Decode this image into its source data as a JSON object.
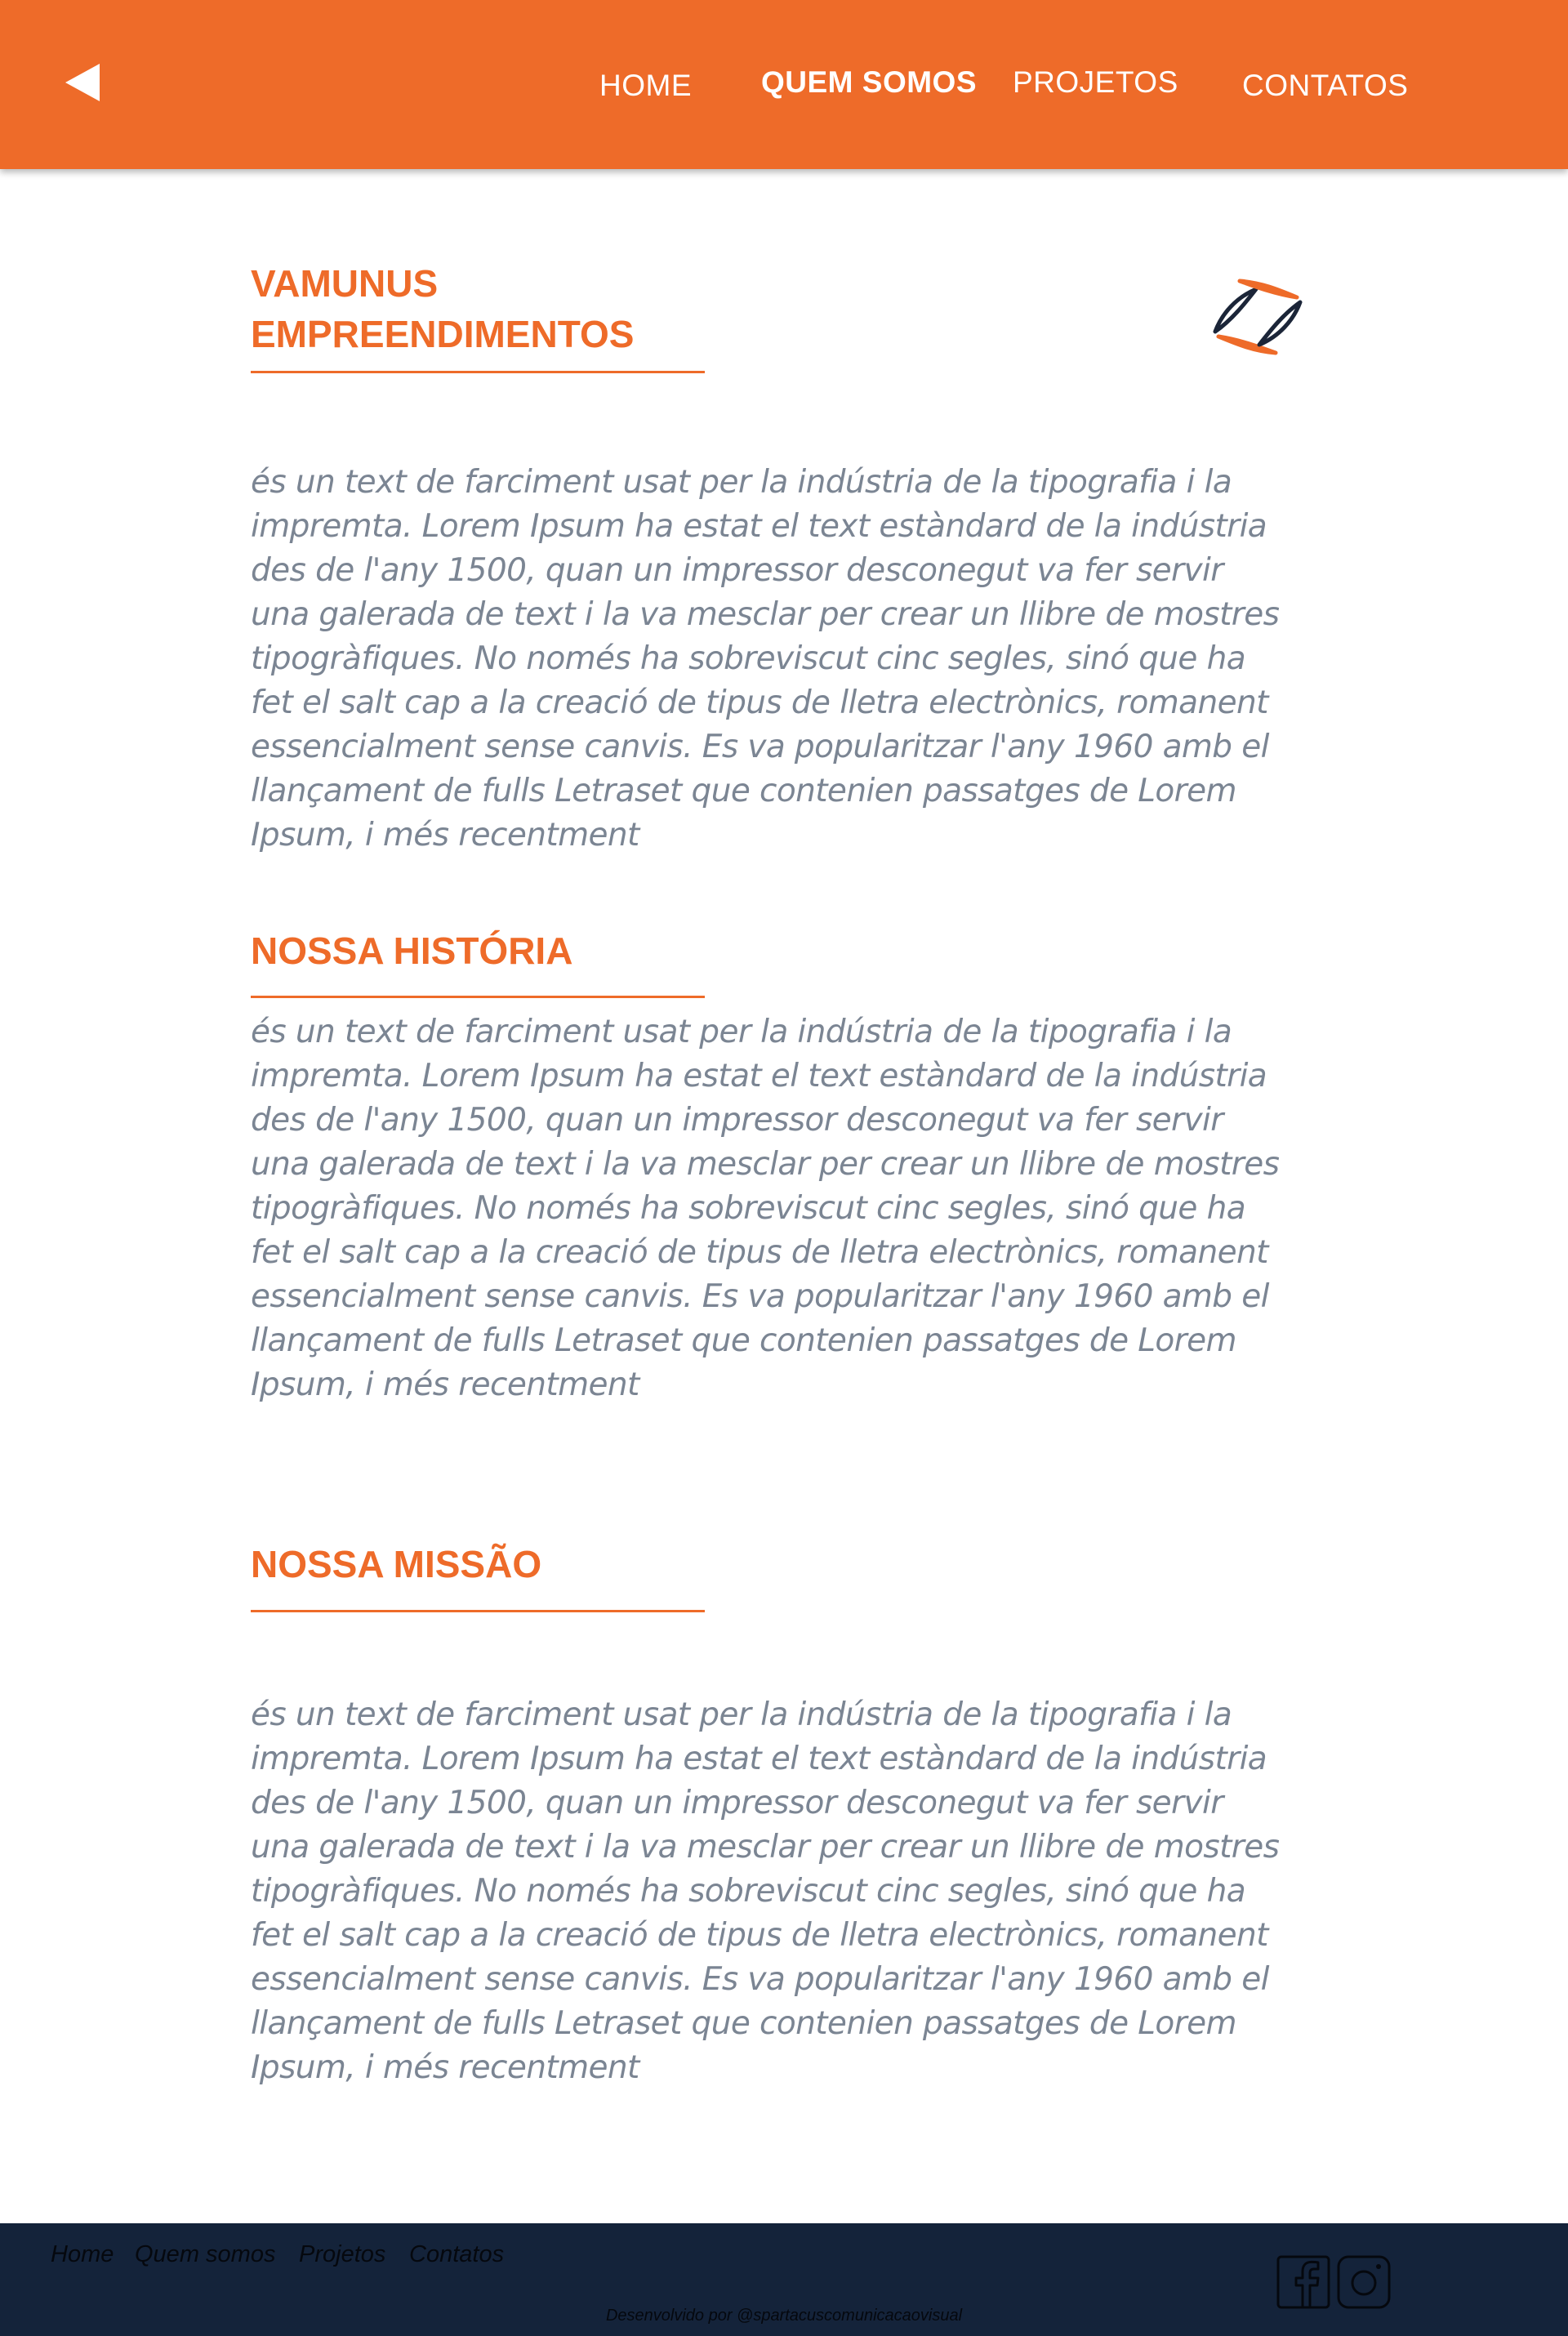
{
  "header": {
    "back_icon": "back-arrow-icon",
    "nav": [
      {
        "label": "HOME",
        "active": false
      },
      {
        "label": "QUEM SOMOS",
        "active": true
      },
      {
        "label": "PROJETOS",
        "active": false
      },
      {
        "label": "CONTATOS",
        "active": false
      }
    ]
  },
  "brand": {
    "heading": "VAMUNUS\nEMPREENDIMENTOS",
    "logo_icon": "vamunus-logo-icon",
    "paragraph": "és un text de farciment usat per la indústria de la tipografia i la impremta. Lorem Ipsum ha estat el text estàndard de la indústria des de l'any 1500, quan un impressor desconegut va fer servir una galerada de text i la va mesclar per crear un llibre de mostres tipogràfiques. No només ha sobreviscut cinc segles, sinó que ha fet el salt cap a la creació de tipus de lletra electrònics, romanent essencialment sense canvis. Es va popularitzar l'any 1960 amb el llançament de fulls Letraset que contenien passatges de Lorem Ipsum, i més recentment"
  },
  "history": {
    "heading": "NOSSA HISTÓRIA",
    "paragraph": "és un text de farciment usat per la indústria de la tipografia i la impremta. Lorem Ipsum ha estat el text estàndard de la indústria des de l'any 1500, quan un impressor desconegut va fer servir una galerada de text i la va mesclar per crear un llibre de mostres tipogràfiques. No només ha sobreviscut cinc segles, sinó que ha fet el salt cap a la creació de tipus de lletra electrònics, romanent essencialment sense canvis. Es va popularitzar l'any 1960 amb el llançament de fulls Letraset que contenien passatges de Lorem Ipsum, i més recentment"
  },
  "mission": {
    "heading": "NOSSA MISSÃO",
    "paragraph": "és un text de farciment usat per la indústria de la tipografia i la impremta. Lorem Ipsum ha estat el text estàndard de la indústria des de l'any 1500, quan un impressor desconegut va fer servir una galerada de text i la va mesclar per crear un llibre de mostres tipogràfiques. No només ha sobreviscut cinc segles, sinó que ha fet el salt cap a la creació de tipus de lletra electrònics, romanent essencialment sense canvis. Es va popularitzar l'any 1960 amb el llançament de fulls Letraset que contenien passatges de Lorem Ipsum, i més recentment"
  },
  "footer": {
    "links": [
      "Home",
      "Quem somos",
      "Projetos",
      "Contatos"
    ],
    "social": [
      "facebook-icon",
      "instagram-icon"
    ],
    "credit": "Desenvolvido por @spartacuscomunicacaovisual"
  },
  "colors": {
    "accent": "#ee6b29",
    "text_gray": "#7b8593",
    "footer_bg": "#14233a",
    "logo_navy": "#1b2538"
  }
}
